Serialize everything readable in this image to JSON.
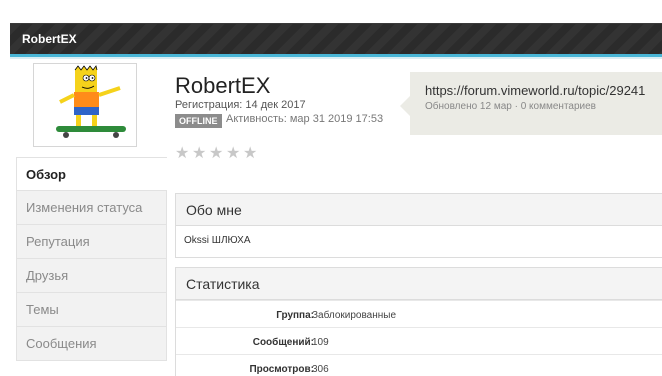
{
  "header": {
    "title": "RobertEX"
  },
  "profile": {
    "name": "RobertEX",
    "registered": "Регистрация: 14 дек 2017",
    "status_badge": "OFFLINE",
    "activity": "Активность: мар 31 2019 17:53",
    "rating_stars": 5
  },
  "status_update": {
    "text": "https://forum.vimeworld.ru/topic/29241",
    "meta": "Обновлено 12 мар · 0 комментариев"
  },
  "menu": {
    "items": [
      {
        "label": "Обзор"
      },
      {
        "label": "Изменения статуса"
      },
      {
        "label": "Репутация"
      },
      {
        "label": "Друзья"
      },
      {
        "label": "Темы"
      },
      {
        "label": "Сообщения"
      }
    ]
  },
  "about": {
    "title": "Обо мне",
    "text": "Okssi ШЛЮХА"
  },
  "stats": {
    "title": "Статистика",
    "rows": [
      {
        "label": "Группа:",
        "value": "Заблокированные"
      },
      {
        "label": "Сообщений:",
        "value": "109"
      },
      {
        "label": "Просмотров:",
        "value": "306"
      }
    ]
  },
  "colors": {
    "header_bg": "#2b2b2b",
    "accent": "#49b6d6",
    "badge_offline": "#8c8c8c",
    "bubble_bg": "#ebebe5"
  }
}
